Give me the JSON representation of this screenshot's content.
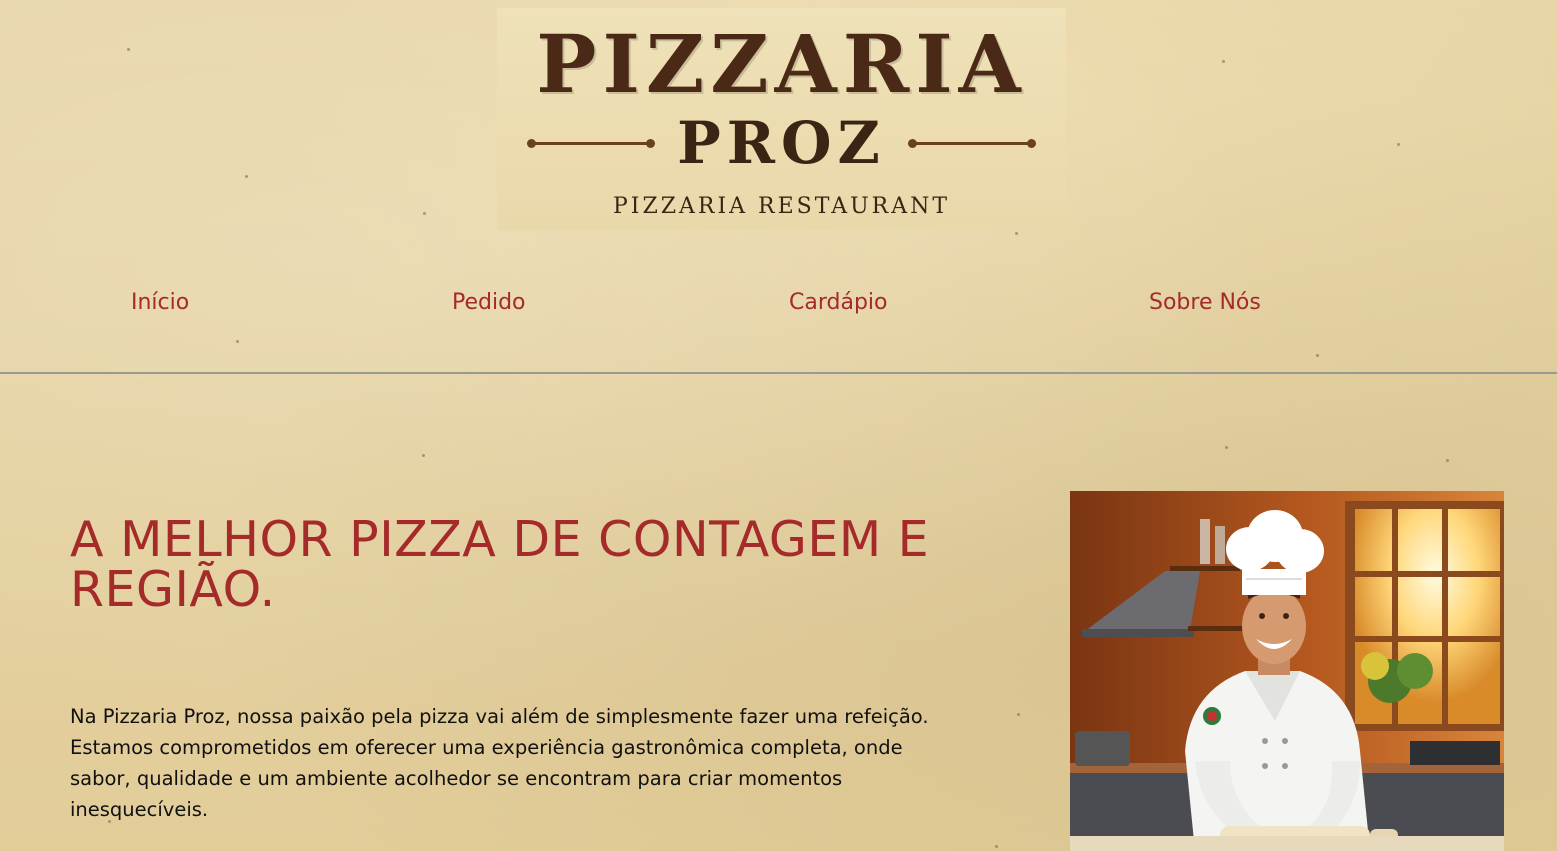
{
  "logo": {
    "title": "PIZZARIA",
    "subtitle": "PROZ",
    "tagline": "PIZZARIA RESTAURANT"
  },
  "nav": {
    "items": [
      "Início",
      "Pedido",
      "Cardápio",
      "Sobre Nós"
    ]
  },
  "hero": {
    "title": "A MELHOR PIZZA DE CONTAGEM E REGIÃO.",
    "text": "Na Pizzaria Proz, nossa paixão pela pizza vai além de simplesmente fazer uma refeição. Estamos comprometidos em oferecer uma experiência gastronômica completa, onde sabor, qualidade e um ambiente acolhedor se encontram para criar momentos inesquecíveis.",
    "image_icon": "chef-illustration"
  },
  "colors": {
    "accent": "#a52a2a",
    "background": "#e6d3a3",
    "logo_text": "#4a2a16"
  }
}
